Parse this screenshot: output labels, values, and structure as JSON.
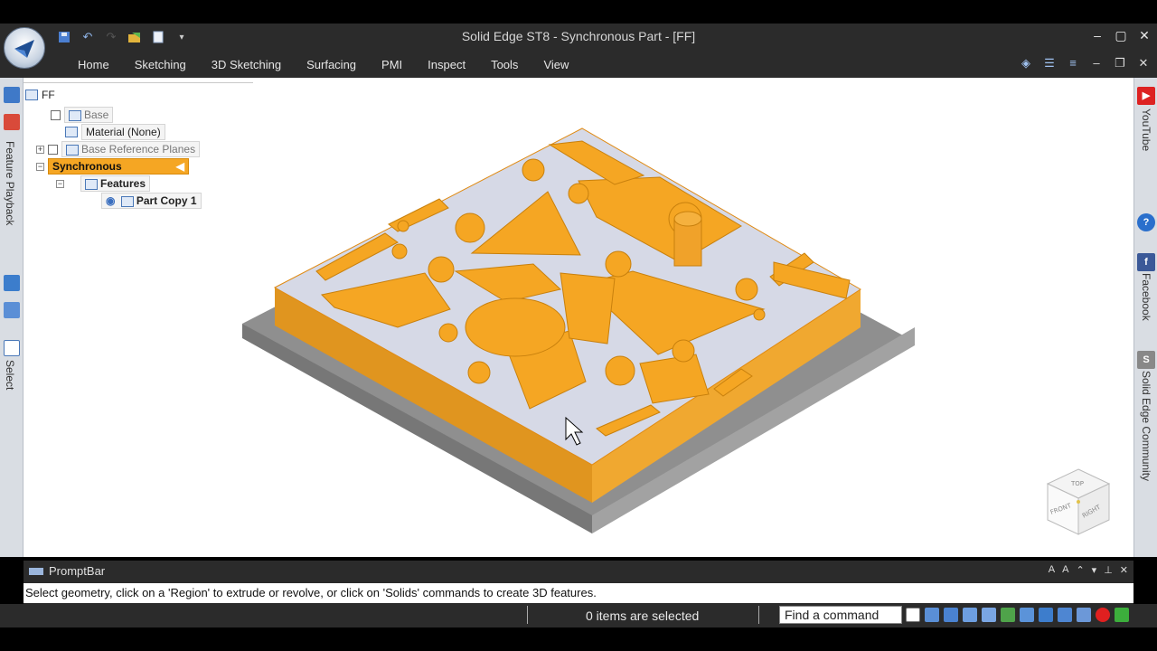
{
  "window": {
    "title": "Solid Edge ST8 - Synchronous Part - [FF]",
    "controls": [
      "minimize-icon",
      "maximize-icon",
      "close-icon"
    ]
  },
  "quick_access": [
    "save-icon",
    "undo-icon",
    "redo-icon",
    "open-icon",
    "new-icon",
    "dropdown-icon"
  ],
  "ribbon": {
    "tabs": [
      "Home",
      "Sketching",
      "3D Sketching",
      "Surfacing",
      "PMI",
      "Inspect",
      "Tools",
      "View"
    ],
    "right_icons": [
      "options-icon",
      "list-icon",
      "layout-icon",
      "minimize-icon",
      "restore-icon",
      "close-icon"
    ]
  },
  "left_strip": {
    "labels": [
      "Feature Playback",
      "Select"
    ]
  },
  "tree": {
    "root": "FF",
    "items": [
      {
        "label": "Base"
      },
      {
        "label": "Material (None)"
      },
      {
        "label": "Base Reference Planes"
      },
      {
        "label": "Synchronous"
      },
      {
        "label": "Features"
      },
      {
        "label": "Part Copy 1"
      }
    ]
  },
  "right_strip": {
    "labels": [
      "YouTube",
      "Facebook",
      "Solid Edge Community"
    ]
  },
  "viewcube": {
    "faces": [
      "TOP",
      "FRONT",
      "RIGHT"
    ]
  },
  "promptbar": {
    "title": "PromptBar",
    "message": "Select geometry, click on a 'Region' to extrude or revolve, or click on 'Solids' commands to create 3D features."
  },
  "statusbar": {
    "selection": "0 items are selected",
    "find_placeholder": "Find a command"
  },
  "colors": {
    "part_face": "#f5a623",
    "part_top": "#d7dbe8",
    "base_plate": "#9b9b9b",
    "selected_node": "#f5a623"
  }
}
